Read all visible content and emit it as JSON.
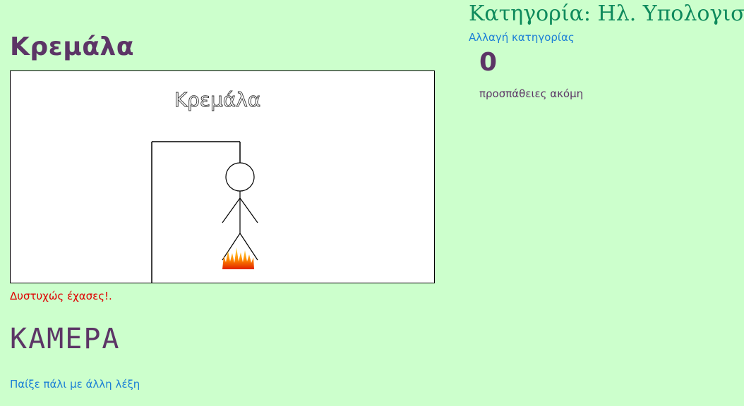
{
  "header": {
    "title": "Κρεμάλα"
  },
  "canvas": {
    "label": "Κρεμάλα"
  },
  "game": {
    "status_message": "Δυστυχώς έχασες!.",
    "word": "ΚΑΜΕΡΑ",
    "play_again_label": "Παίξε πάλι με άλλη λέξη"
  },
  "sidebar": {
    "category_title": "Κατηγορία: Ηλ. Υπολογιστές",
    "change_category_label": "Αλλαγή κατηγορίας",
    "attempts_left": "0",
    "attempts_label": "προσπάθειες ακόμη"
  },
  "colors": {
    "background": "#ccffcc",
    "title": "#5c3566",
    "category": "#0e8a5c",
    "link": "#1a7fd6",
    "error": "#e00000"
  },
  "icons": {
    "gallows": "gallows-icon",
    "stickman": "stickman-icon",
    "fire": "fire-icon"
  }
}
